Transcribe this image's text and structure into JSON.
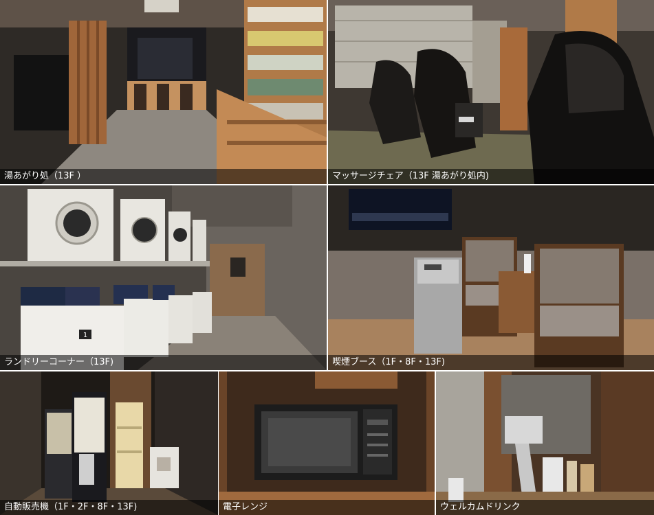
{
  "captions": {
    "lounge": "湯あがり処（13F ）",
    "massage": "マッサージチェア（13F 湯あがり処内)",
    "laundry": "ランドリーコーナー（13F)",
    "smoking": "喫煙ブース（1F・8F・13F)",
    "vending": "自動販売機（1F・2F・8F・13F)",
    "microwave": "電子レンジ",
    "welcome": "ウェルカムドリンク"
  },
  "labels": {
    "washer_number": "1"
  },
  "colors": {
    "caption_bg": "#000000",
    "caption_text": "#ffffff",
    "wood": "#a0663a",
    "dark_wall": "#3a332d",
    "appliance_white": "#e8e6e0"
  }
}
